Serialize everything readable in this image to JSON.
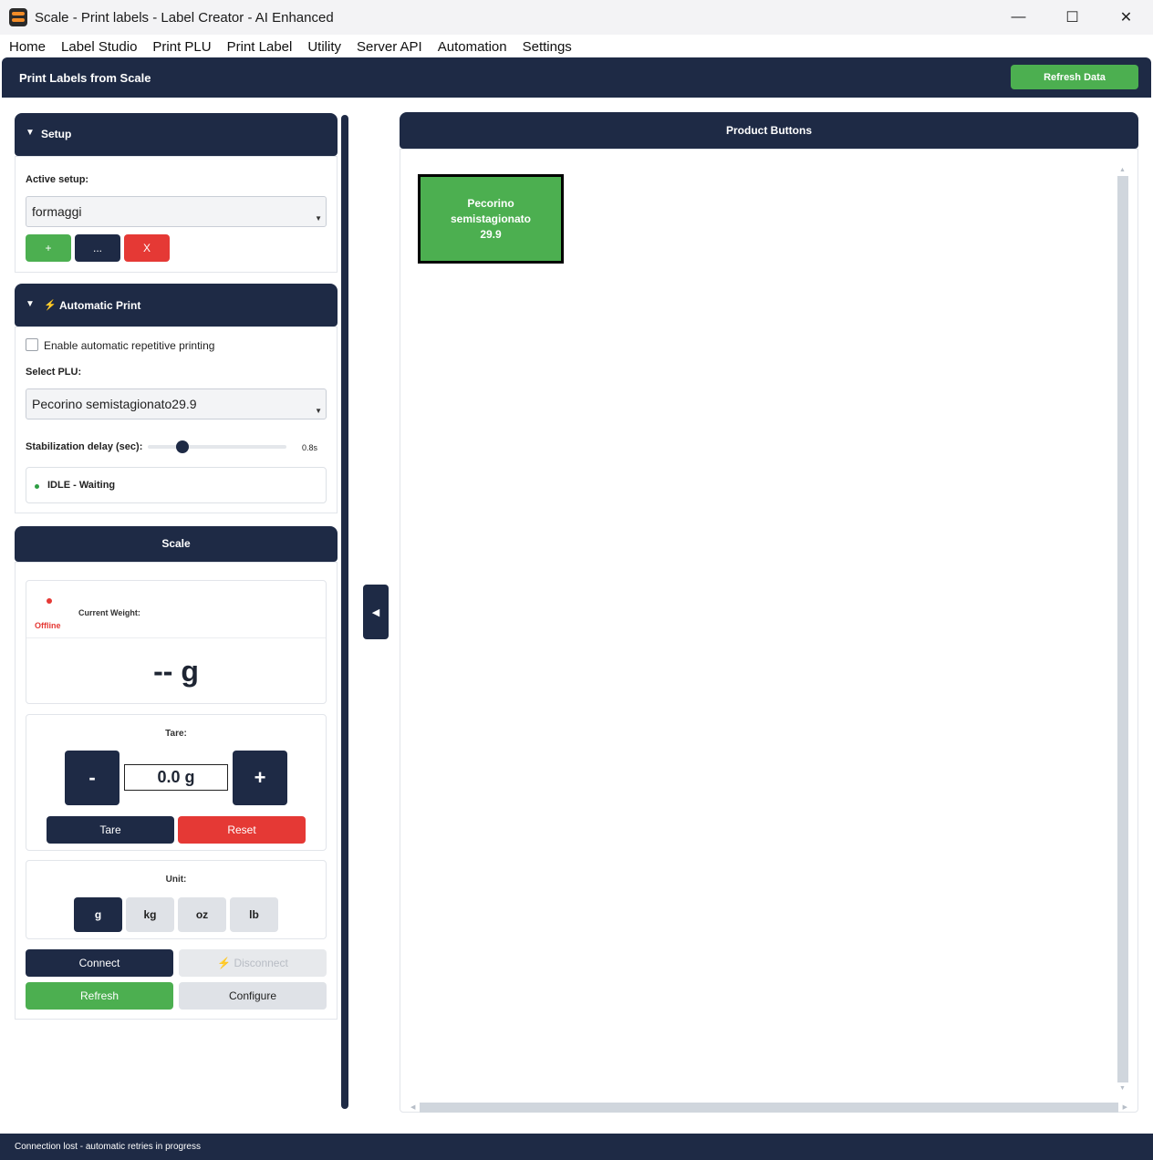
{
  "window": {
    "title": "Scale - Print labels - Label Creator - AI Enhanced",
    "minimize": "—",
    "maximize": "☐",
    "close": "✕"
  },
  "menu": [
    "Home",
    "Label Studio",
    "Print PLU",
    "Print Label",
    "Utility",
    "Server API",
    "Automation",
    "Settings"
  ],
  "header": {
    "title": "Print Labels from Scale",
    "refresh_label": "Refresh Data"
  },
  "setup": {
    "title": "Setup",
    "toggle": "▼",
    "active_label": "Active setup:",
    "selected": "formaggi",
    "add_label": "+",
    "more_label": "...",
    "delete_label": "X"
  },
  "auto_print": {
    "title": "Automatic Print",
    "toggle": "▼",
    "bolt": "⚡",
    "enable_label": "Enable automatic repetitive printing",
    "enabled": false,
    "plu_label": "Select PLU:",
    "plu_selected": "Pecorino semistagionato29.9",
    "delay_label": "Stabilization delay (sec):",
    "delay_value": 0.8,
    "delay_max": 5,
    "delay_text": "0.8s",
    "status_text": "IDLE - Waiting",
    "status_color": "#2e9e44"
  },
  "scale": {
    "title": "Scale",
    "connection_status": "Offline",
    "status_color": "#e53935",
    "current_weight_label": "Current Weight:",
    "weight_display": "-- g",
    "tare_label": "Tare:",
    "tare_minus": "-",
    "tare_plus": "+",
    "tare_value": "0.0 g",
    "tare_button": "Tare",
    "reset_button": "Reset",
    "unit_label": "Unit:",
    "units": [
      "g",
      "kg",
      "oz",
      "lb"
    ],
    "selected_unit": "g",
    "connect_button": "Connect",
    "disconnect_button": "⚡ Disconnect",
    "refresh_button": "Refresh",
    "configure_button": "Configure"
  },
  "collapse_arrow": "◀",
  "products": {
    "title": "Product Buttons",
    "items": [
      {
        "name": "Pecorino semistagionato",
        "price": "29.9"
      }
    ]
  },
  "status_bar": {
    "text": "Connection lost - automatic retries in progress"
  },
  "colors": {
    "navy": "#1e2a45",
    "green": "#4caf50",
    "red": "#e53935"
  }
}
